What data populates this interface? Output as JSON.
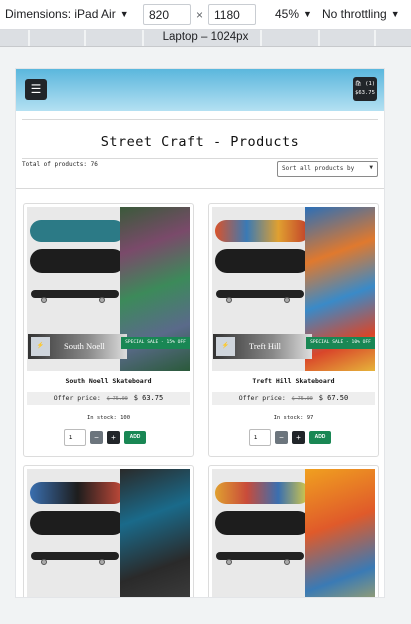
{
  "devtools": {
    "device": "Dimensions: iPad Air",
    "width": "820",
    "height": "1180",
    "zoom": "45%",
    "throttling": "No throttling",
    "breakpoint_label": "Laptop – 1024px"
  },
  "site": {
    "menu_icon": "☰",
    "cart": {
      "count": "(1)",
      "total": "$63.75"
    },
    "title": "Street Craft - Products",
    "total_products": "Total of products: 76",
    "sort_placeholder": "Sort all products by"
  },
  "products": [
    {
      "name": "South Noell Skateboard",
      "stamp_name": "South Noell",
      "badge": "SPECIAL SALE - 15% OFF",
      "offer_label": "Offer price:",
      "old_price": "$ 75.00",
      "new_price": "$ 63.75",
      "stock": "In stock: 100",
      "qty": "1",
      "add_label": "ADD",
      "colors": {
        "deck1": "#2c7a86",
        "graffiti": "#4a6b4e"
      }
    },
    {
      "name": "Treft Hill Skateboard",
      "stamp_name": "Treft Hill",
      "badge": "SPECIAL SALE - 10% OFF",
      "offer_label": "Offer price:",
      "old_price": "$ 75.00",
      "new_price": "$ 67.50",
      "stock": "In stock: 97",
      "qty": "1",
      "add_label": "ADD",
      "colors": {
        "deck1": "#d9532b",
        "graffiti": "#e0792e"
      }
    },
    {
      "colors": {
        "deck1": "#3a6fb0",
        "graffiti": "#2a2a2a"
      }
    },
    {
      "colors": {
        "deck1": "#c94b3a",
        "graffiti": "#f0a020"
      }
    }
  ]
}
